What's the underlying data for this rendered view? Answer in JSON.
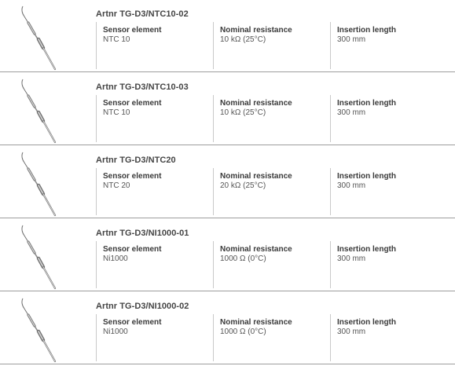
{
  "products": [
    {
      "title": "Artnr TG-D3/NTC10-02",
      "image": "temperature-probe-icon",
      "specs": [
        {
          "label": "Sensor element",
          "value": "NTC 10"
        },
        {
          "label": "Nominal resistance",
          "value": "10 kΩ (25°C)"
        },
        {
          "label": "Insertion length",
          "value": "300 mm"
        }
      ]
    },
    {
      "title": "Artnr TG-D3/NTC10-03",
      "image": "temperature-probe-icon",
      "specs": [
        {
          "label": "Sensor element",
          "value": "NTC 10"
        },
        {
          "label": "Nominal resistance",
          "value": "10 kΩ (25°C)"
        },
        {
          "label": "Insertion length",
          "value": "300 mm"
        }
      ]
    },
    {
      "title": "Artnr TG-D3/NTC20",
      "image": "temperature-probe-icon",
      "specs": [
        {
          "label": "Sensor element",
          "value": "NTC 20"
        },
        {
          "label": "Nominal resistance",
          "value": "20 kΩ (25°C)"
        },
        {
          "label": "Insertion length",
          "value": "300 mm"
        }
      ]
    },
    {
      "title": "Artnr TG-D3/NI1000-01",
      "image": "temperature-probe-icon",
      "specs": [
        {
          "label": "Sensor element",
          "value": "Ni1000"
        },
        {
          "label": "Nominal resistance",
          "value": "1000 Ω (0°C)"
        },
        {
          "label": "Insertion length",
          "value": "300 mm"
        }
      ]
    },
    {
      "title": "Artnr TG-D3/NI1000-02",
      "image": "temperature-probe-icon",
      "specs": [
        {
          "label": "Sensor element",
          "value": "Ni1000"
        },
        {
          "label": "Nominal resistance",
          "value": "1000 Ω (0°C)"
        },
        {
          "label": "Insertion length",
          "value": "300 mm"
        }
      ]
    }
  ]
}
